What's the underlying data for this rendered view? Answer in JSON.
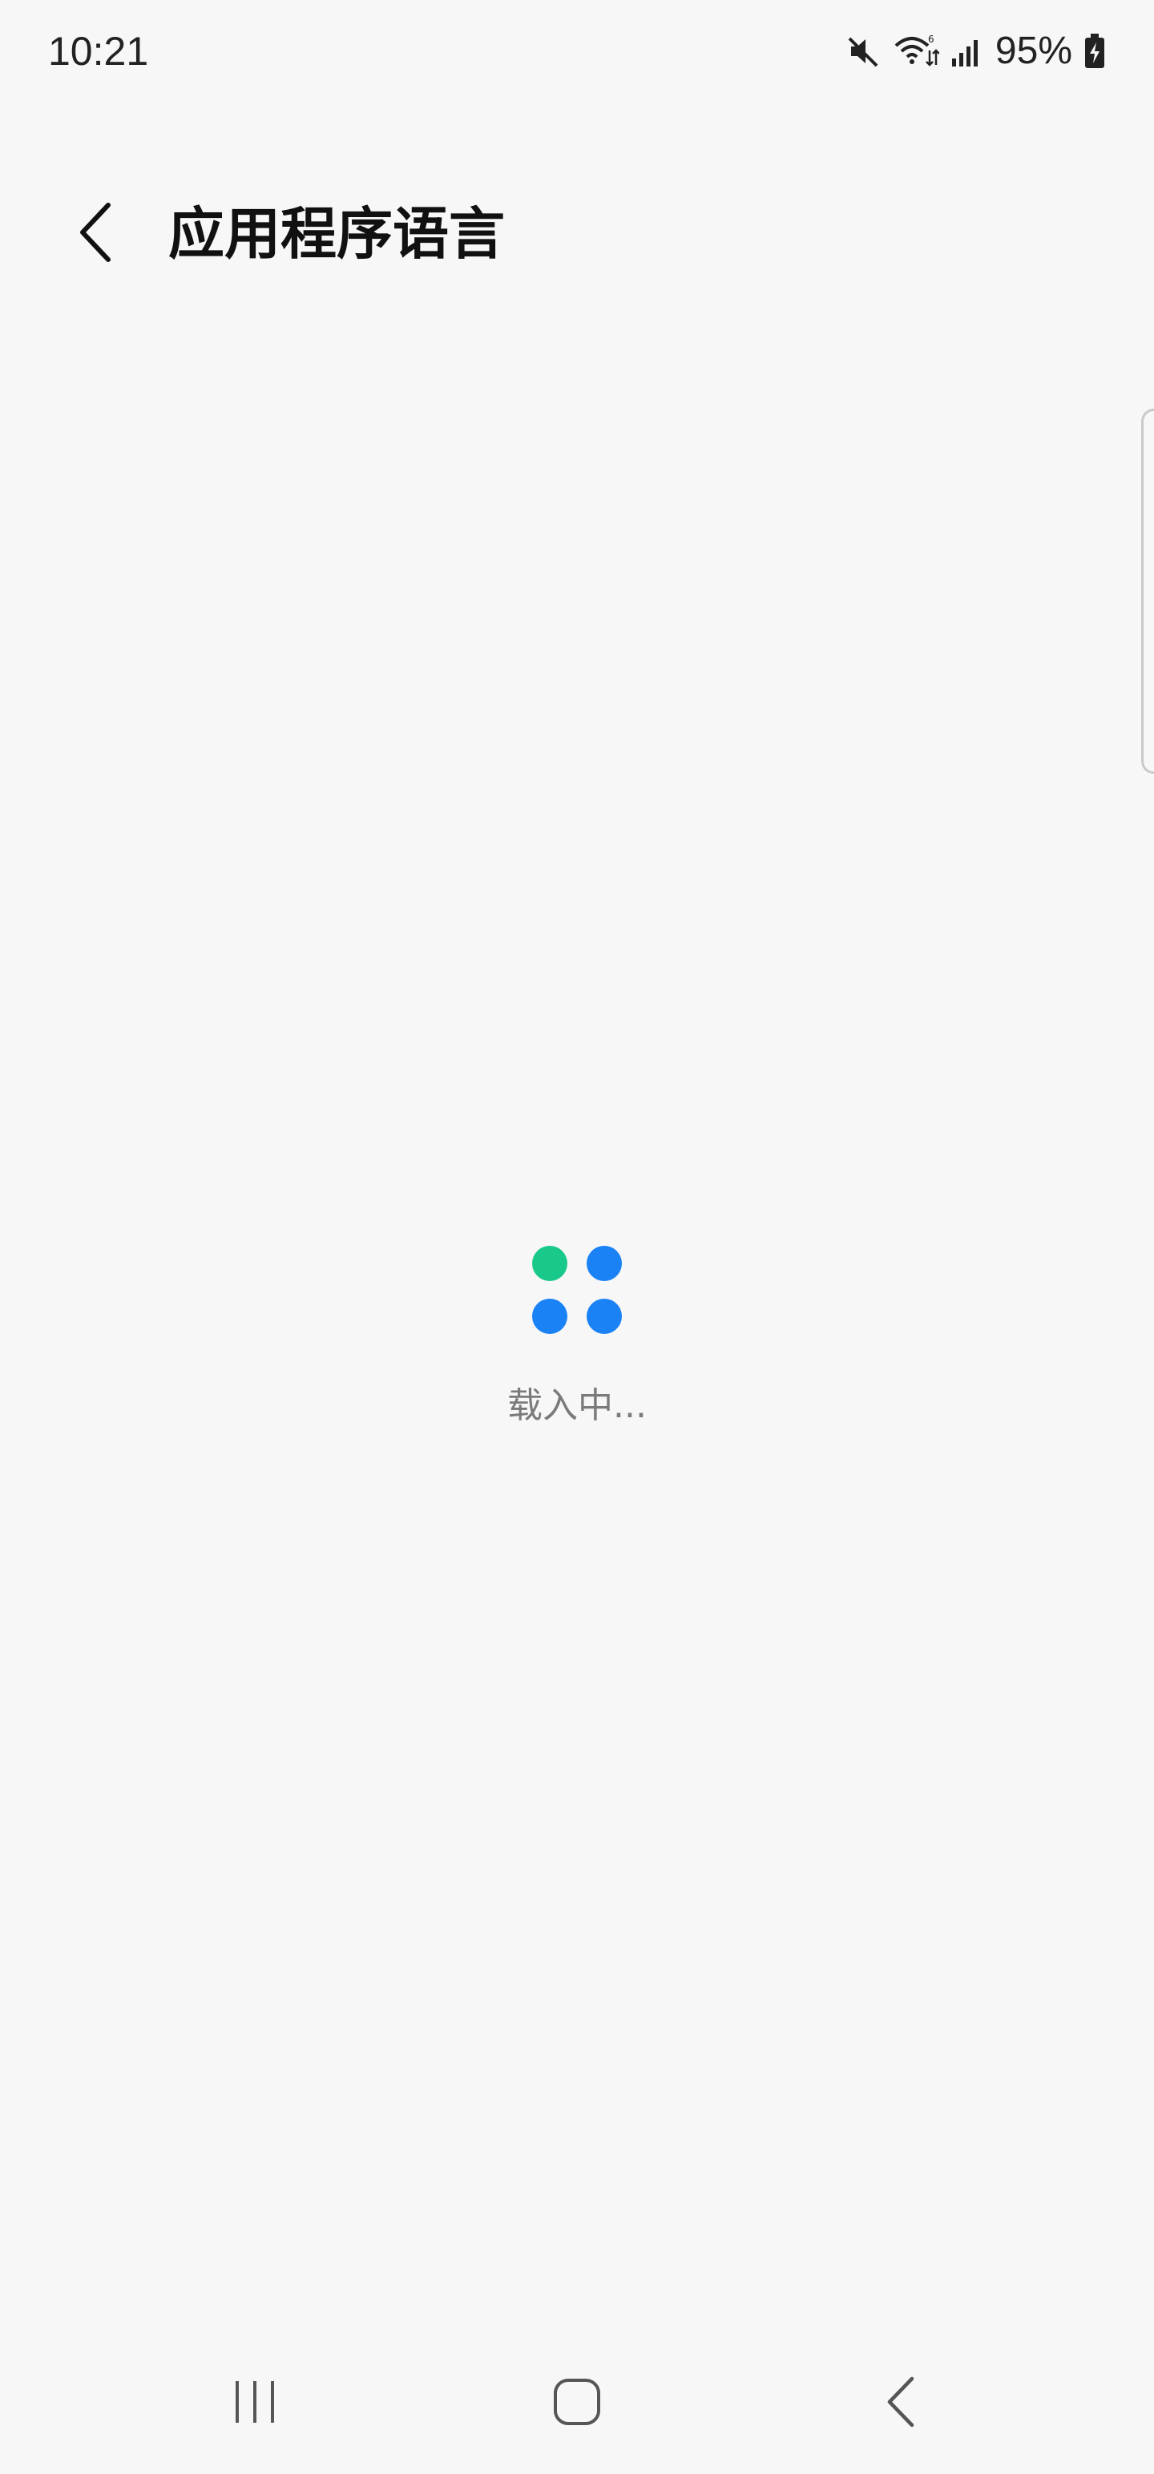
{
  "status_bar": {
    "time": "10:21",
    "battery_percent": "95%",
    "icons": [
      "mute-icon",
      "wifi-icon",
      "signal-icon",
      "battery-charging-icon"
    ]
  },
  "app_bar": {
    "title": "应用程序语言",
    "back_icon": "chevron-left-icon"
  },
  "loader": {
    "text": "载入中...",
    "dot_colors": [
      "#19c98a",
      "#1a82f5",
      "#1a82f5",
      "#1a82f5"
    ]
  },
  "nav_bar": {
    "buttons": [
      "recents-icon",
      "home-icon",
      "back-icon"
    ]
  },
  "colors": {
    "background": "#f7f7f7",
    "accent_green": "#19c98a",
    "accent_blue": "#1a82f5"
  }
}
